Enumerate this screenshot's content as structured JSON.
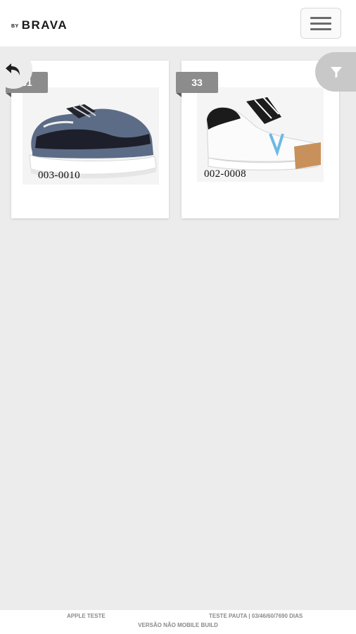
{
  "header": {
    "logo_prefix": "BY",
    "logo_name": "BRAVA"
  },
  "products": [
    {
      "badge": "31",
      "code": "003-0010"
    },
    {
      "badge": "33",
      "code": "002-0008"
    }
  ],
  "footer": {
    "left": "APPLE TESTE",
    "right": "TESTE PAUTA | 03/46/60/7690 DIAS",
    "center": "VERSÃO NÃO MOBILE BUILD"
  },
  "colors": {
    "background": "#ececec",
    "badge": "#8c8c8c",
    "filter_button": "#c8c8c8"
  },
  "icons": {
    "back": "undo-arrow-icon",
    "filter": "filter-funnel-icon",
    "menu": "hamburger-menu-icon"
  }
}
